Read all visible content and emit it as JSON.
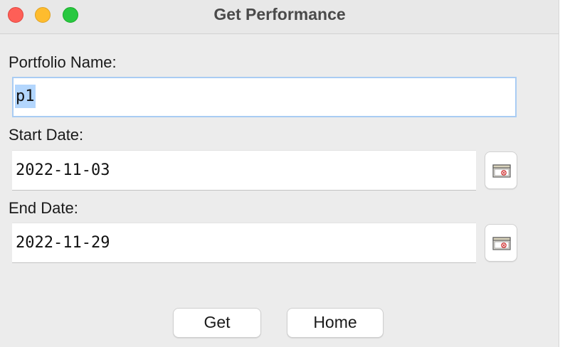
{
  "window": {
    "title": "Get Performance",
    "traffic_lights": {
      "close": "#fe5f57",
      "minimize": "#febc2e",
      "zoom": "#28c840"
    }
  },
  "form": {
    "portfolio_label": "Portfolio Name:",
    "portfolio_value": "p1",
    "start_label": "Start Date:",
    "start_value": "2022-11-03",
    "end_label": "End Date:",
    "end_value": "2022-11-29",
    "calendar_icon": "calendar-picker-icon"
  },
  "buttons": {
    "get_label": "Get",
    "home_label": "Home"
  },
  "colors": {
    "focus_border": "#a9ccf3",
    "selection": "#b3d6fd",
    "window_bg": "#ececec"
  }
}
